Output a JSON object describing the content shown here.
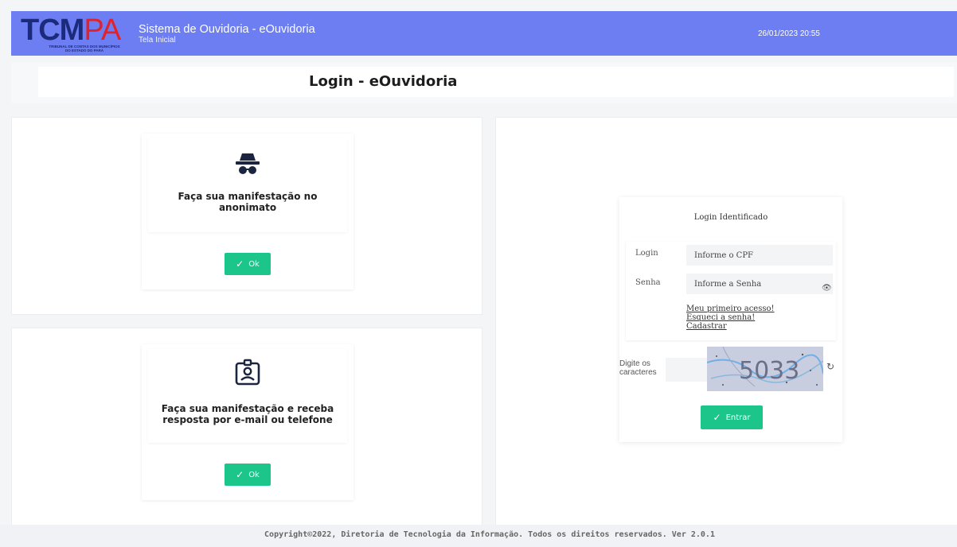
{
  "header": {
    "logo_main": "TCM",
    "logo_pa": "PA",
    "logo_sub_line1": "TRIBUNAL DE CONTAS DOS MUNICÍPIOS",
    "logo_sub_line2": "DO ESTADO DO PARÁ",
    "system_title": "Sistema de Ouvidoria - eOuvidoria",
    "subtitle": "Tela Inicial",
    "datetime": "26/01/2023 20:55",
    "bg_color": "#6c7ef2"
  },
  "page_title": "Login - eOuvidoria",
  "anonymous": {
    "icon": "incognito-icon",
    "text_line1": "Faça sua manifestação no",
    "text_line2": "anonimato",
    "button_label": "Ok"
  },
  "identified": {
    "icon": "user-badge-icon",
    "text_line1": "Faça sua manifestação e receba",
    "text_line2": "resposta por e-mail ou telefone",
    "button_label": "Ok"
  },
  "login": {
    "heading": "Login Identificado",
    "login_label": "Login",
    "login_placeholder": "Informe o CPF",
    "password_label": "Senha",
    "password_placeholder": "Informe a Senha",
    "link_first_access": "Meu primeiro acesso!",
    "link_forgot": "Esqueci a senha!",
    "link_register": "Cadastrar",
    "captcha_label_line1": "Digite os",
    "captcha_label_line2": "caracteres",
    "captcha_text": "5033",
    "submit_label": "Entrar"
  },
  "footer": "Copyright©2022, Diretoria de Tecnologia da Informação. Todos os direitos reservados. Ver 2.0.1",
  "colors": {
    "accent": "#1cc58a"
  }
}
